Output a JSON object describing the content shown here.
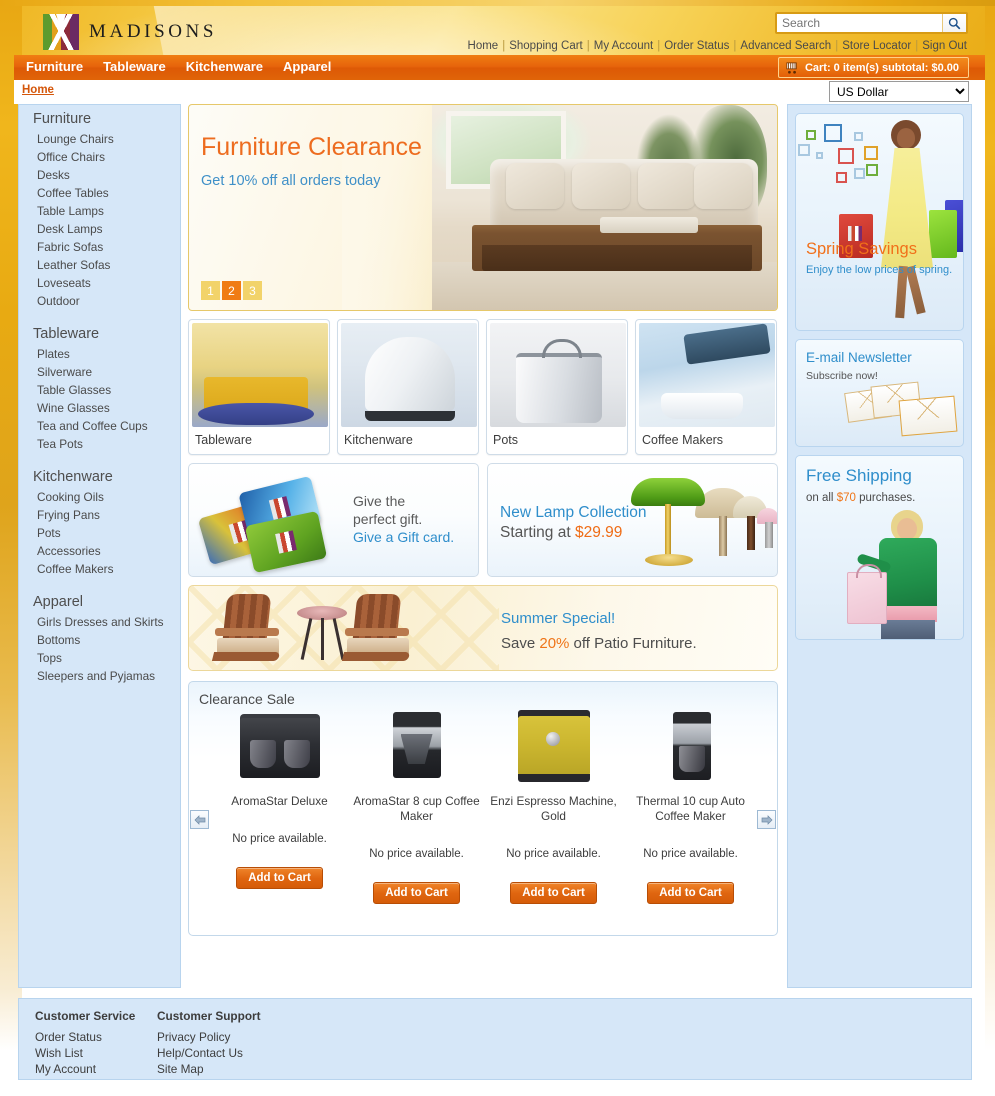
{
  "header": {
    "brand": "MADISONS",
    "search": {
      "value": "",
      "placeholder": "Search",
      "icon": "search-icon"
    },
    "top_links": [
      "Home",
      "Shopping Cart",
      "My Account",
      "Order Status",
      "Advanced Search",
      "Store Locator",
      "Sign Out"
    ]
  },
  "nav": {
    "items": [
      "Furniture",
      "Tableware",
      "Kitchenware",
      "Apparel"
    ],
    "cart": {
      "label": "Cart: 0 item(s) subtotal: $0.00",
      "icon": "shopping-cart-icon"
    }
  },
  "breadcrumb": {
    "label": "Home"
  },
  "currency": {
    "selected": "US Dollar",
    "options": [
      "US Dollar"
    ]
  },
  "sidebar": {
    "groups": [
      {
        "title": "Furniture",
        "links": [
          "Lounge Chairs",
          "Office Chairs",
          "Desks",
          "Coffee Tables",
          "Table Lamps",
          "Desk Lamps",
          "Fabric Sofas",
          "Leather Sofas",
          "Loveseats",
          "Outdoor"
        ]
      },
      {
        "title": "Tableware",
        "links": [
          "Plates",
          "Silverware",
          "Table Glasses",
          "Wine Glasses",
          "Tea and Coffee Cups",
          "Tea Pots"
        ]
      },
      {
        "title": "Kitchenware",
        "links": [
          "Cooking Oils",
          "Frying Pans",
          "Pots",
          "Accessories",
          "Coffee Makers"
        ]
      },
      {
        "title": "Apparel",
        "links": [
          "Girls Dresses and Skirts",
          "Bottoms",
          "Tops",
          "Sleepers and Pyjamas"
        ]
      }
    ]
  },
  "hero": {
    "title": "Furniture Clearance",
    "subtitle": "Get 10% off all orders today",
    "slides": [
      "1",
      "2",
      "3"
    ],
    "active_slide": "2"
  },
  "tiles": [
    {
      "label": "Tableware"
    },
    {
      "label": "Kitchenware"
    },
    {
      "label": "Pots"
    },
    {
      "label": "Coffee Makers"
    }
  ],
  "promos": {
    "gift": {
      "line1": "Give the",
      "line2": "perfect gift.",
      "line3": "Give a Gift card."
    },
    "lamp": {
      "line1": "New Lamp Collection",
      "line2_prefix": "Starting at ",
      "price": "$29.99"
    },
    "summer": {
      "line1": "Summer Special!",
      "line2_prefix": "Save ",
      "percent": "20%",
      "line2_suffix": " off Patio Furniture."
    }
  },
  "clearance": {
    "title": "Clearance Sale",
    "prev_label": "◀",
    "next_label": "▶",
    "products": [
      {
        "name": "AromaStar Deluxe",
        "price": "No price available.",
        "cart_label": "Add to Cart"
      },
      {
        "name": "AromaStar 8 cup Coffee Maker",
        "price": "No price available.",
        "cart_label": "Add to Cart"
      },
      {
        "name": "Enzi Espresso Machine, Gold",
        "price": "No price available.",
        "cart_label": "Add to Cart"
      },
      {
        "name": "Thermal 10 cup Auto Coffee Maker",
        "price": "No price available.",
        "cart_label": "Add to Cart"
      }
    ]
  },
  "right_promos": {
    "spring": {
      "title": "Spring Savings",
      "subtitle": "Enjoy the low prices of spring."
    },
    "newsletter": {
      "title": "E-mail Newsletter",
      "subtitle": "Subscribe now!"
    },
    "shipping": {
      "title": "Free Shipping",
      "prefix": "on all ",
      "amount": "$70",
      "suffix": " purchases."
    }
  },
  "footer": {
    "columns": [
      {
        "head": "Customer Service",
        "links": [
          "Order Status",
          "Wish List",
          "My Account"
        ]
      },
      {
        "head": "Customer Support",
        "links": [
          "Privacy Policy",
          "Help/Contact Us",
          "Site Map"
        ]
      }
    ]
  },
  "colors": {
    "accent_orange": "#e6620b",
    "gold": "#e8a713",
    "link_blue": "#2f8ecb",
    "panel_blue": "#d6e7f8"
  }
}
